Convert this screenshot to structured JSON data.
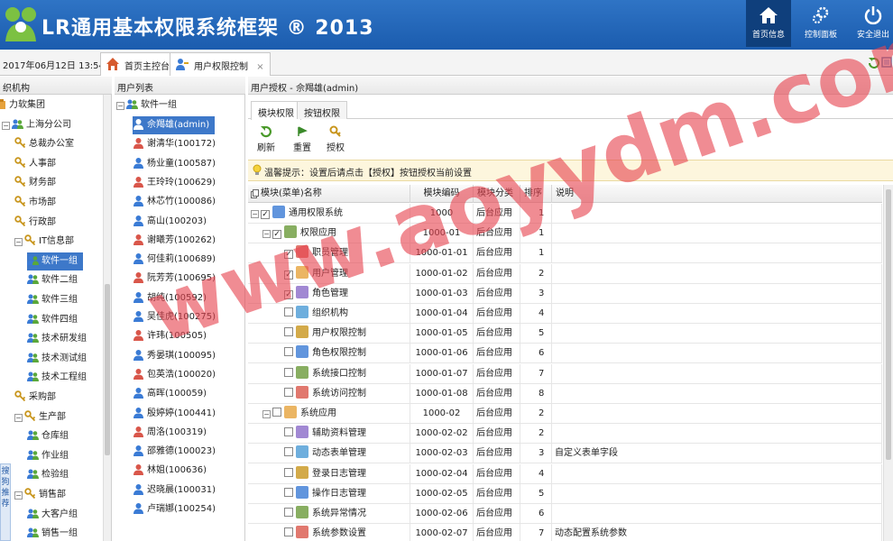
{
  "app": {
    "title": "LR通用基本权限系统框架 ® 2013",
    "buttons": [
      {
        "label": "首页信息",
        "icon": "home-icon"
      },
      {
        "label": "控制面板",
        "icon": "gears-icon"
      },
      {
        "label": "安全退出",
        "icon": "power-icon"
      }
    ]
  },
  "tabbar": {
    "datetime": "2017年06月12日 13:54:48",
    "tabs": [
      {
        "label": "首页主控台"
      },
      {
        "label": "用户权限控制",
        "close": "×"
      }
    ]
  },
  "org_panel": {
    "title": "织机构",
    "items": [
      {
        "label": "力软集团",
        "level": 0
      },
      {
        "label": "上海分公司",
        "level": 1,
        "expander": "−"
      },
      {
        "label": "总裁办公室",
        "level": 2
      },
      {
        "label": "人事部",
        "level": 2
      },
      {
        "label": "财务部",
        "level": 2
      },
      {
        "label": "市场部",
        "level": 2
      },
      {
        "label": "行政部",
        "level": 2
      },
      {
        "label": "IT信息部",
        "level": 2,
        "expander": "−"
      },
      {
        "label": "软件一组",
        "level": 3,
        "selected": true
      },
      {
        "label": "软件二组",
        "level": 3
      },
      {
        "label": "软件三组",
        "level": 3
      },
      {
        "label": "软件四组",
        "level": 3
      },
      {
        "label": "技术研发组",
        "level": 3
      },
      {
        "label": "技术测试组",
        "level": 3
      },
      {
        "label": "技术工程组",
        "level": 3
      },
      {
        "label": "采购部",
        "level": 2
      },
      {
        "label": "生产部",
        "level": 2,
        "expander": "−"
      },
      {
        "label": "仓库组",
        "level": 3
      },
      {
        "label": "作业组",
        "level": 3
      },
      {
        "label": "检验组",
        "level": 3
      },
      {
        "label": "销售部",
        "level": 2,
        "expander": "−"
      },
      {
        "label": "大客户组",
        "level": 3
      },
      {
        "label": "销售一组",
        "level": 3
      }
    ]
  },
  "user_panel": {
    "title": "用户列表",
    "group": {
      "label": "软件一组",
      "expander": "−"
    },
    "users": [
      {
        "label": "佘羯雄(admin)",
        "selected": true
      },
      {
        "label": "谢清华(100172)"
      },
      {
        "label": "杨业童(100587)"
      },
      {
        "label": "王玲玲(100629)"
      },
      {
        "label": "林芯竹(100086)"
      },
      {
        "label": "高山(100203)"
      },
      {
        "label": "谢曦芳(100262)"
      },
      {
        "label": "何佳莉(100689)"
      },
      {
        "label": "阮芳芳(100695)"
      },
      {
        "label": "胡纯(100592)"
      },
      {
        "label": "吴佳虎(100275)"
      },
      {
        "label": "许玮(100505)"
      },
      {
        "label": "秀晏琪(100095)"
      },
      {
        "label": "包英浩(100020)"
      },
      {
        "label": "高晖(100059)"
      },
      {
        "label": "殷婷婷(100441)"
      },
      {
        "label": "周洛(100319)"
      },
      {
        "label": "邵雅德(100023)"
      },
      {
        "label": "林姐(100636)"
      },
      {
        "label": "迟晓晨(100031)"
      },
      {
        "label": "卢瑞娜(100254)"
      }
    ]
  },
  "main": {
    "title": "用户授权 - 佘羯雄(admin)",
    "tabs": [
      {
        "label": "模块权限"
      },
      {
        "label": "按钮权限"
      }
    ],
    "toolbar": [
      {
        "label": "刷新"
      },
      {
        "label": "重置"
      },
      {
        "label": "授权"
      }
    ],
    "hint": "温馨提示：设置后请点击【授权】按钮授权当前设置",
    "grid": {
      "columns": {
        "name": "模块(菜单)名称",
        "code": "模块编码",
        "category": "模块分类",
        "order": "排序",
        "remark": "说明"
      },
      "rows": [
        {
          "name": "通用权限系统",
          "code": "1000",
          "category": "后台应用",
          "order": "1",
          "remark": "",
          "level": 0,
          "expander": "−",
          "checked": true
        },
        {
          "name": "权限应用",
          "code": "1000-01",
          "category": "后台应用",
          "order": "1",
          "remark": "",
          "level": 1,
          "expander": "−",
          "checked": true
        },
        {
          "name": "职员管理",
          "code": "1000-01-01",
          "category": "后台应用",
          "order": "1",
          "remark": "",
          "level": 2,
          "checked": true
        },
        {
          "name": "用户管理",
          "code": "1000-01-02",
          "category": "后台应用",
          "order": "2",
          "remark": "",
          "level": 2,
          "checked": true
        },
        {
          "name": "角色管理",
          "code": "1000-01-03",
          "category": "后台应用",
          "order": "3",
          "remark": "",
          "level": 2,
          "checked": true
        },
        {
          "name": "组织机构",
          "code": "1000-01-04",
          "category": "后台应用",
          "order": "4",
          "remark": "",
          "level": 2,
          "checked": false
        },
        {
          "name": "用户权限控制",
          "code": "1000-01-05",
          "category": "后台应用",
          "order": "5",
          "remark": "",
          "level": 2,
          "checked": false
        },
        {
          "name": "角色权限控制",
          "code": "1000-01-06",
          "category": "后台应用",
          "order": "6",
          "remark": "",
          "level": 2,
          "checked": false
        },
        {
          "name": "系统接口控制",
          "code": "1000-01-07",
          "category": "后台应用",
          "order": "7",
          "remark": "",
          "level": 2,
          "checked": false
        },
        {
          "name": "系统访问控制",
          "code": "1000-01-08",
          "category": "后台应用",
          "order": "8",
          "remark": "",
          "level": 2,
          "checked": false
        },
        {
          "name": "系统应用",
          "code": "1000-02",
          "category": "后台应用",
          "order": "2",
          "remark": "",
          "level": 1,
          "expander": "−",
          "checked": false
        },
        {
          "name": "辅助资料管理",
          "code": "1000-02-02",
          "category": "后台应用",
          "order": "2",
          "remark": "",
          "level": 2,
          "checked": false
        },
        {
          "name": "动态表单管理",
          "code": "1000-02-03",
          "category": "后台应用",
          "order": "3",
          "remark": "自定义表单字段",
          "level": 2,
          "checked": false
        },
        {
          "name": "登录日志管理",
          "code": "1000-02-04",
          "category": "后台应用",
          "order": "4",
          "remark": "",
          "level": 2,
          "checked": false
        },
        {
          "name": "操作日志管理",
          "code": "1000-02-05",
          "category": "后台应用",
          "order": "5",
          "remark": "",
          "level": 2,
          "checked": false
        },
        {
          "name": "系统异常情况",
          "code": "1000-02-06",
          "category": "后台应用",
          "order": "6",
          "remark": "",
          "level": 2,
          "checked": false
        },
        {
          "name": "系统参数设置",
          "code": "1000-02-07",
          "category": "后台应用",
          "order": "7",
          "remark": "动态配置系统参数",
          "level": 2,
          "checked": false
        }
      ]
    }
  },
  "sticker": {
    "label": "搜狗推荐"
  },
  "watermark": {
    "text": "www.aoyydm.com"
  },
  "colors": {
    "header": "#1f63b5",
    "selected": "#3d78c9",
    "hint_bg": "#fdf6dd",
    "watermark": "#e64650"
  }
}
